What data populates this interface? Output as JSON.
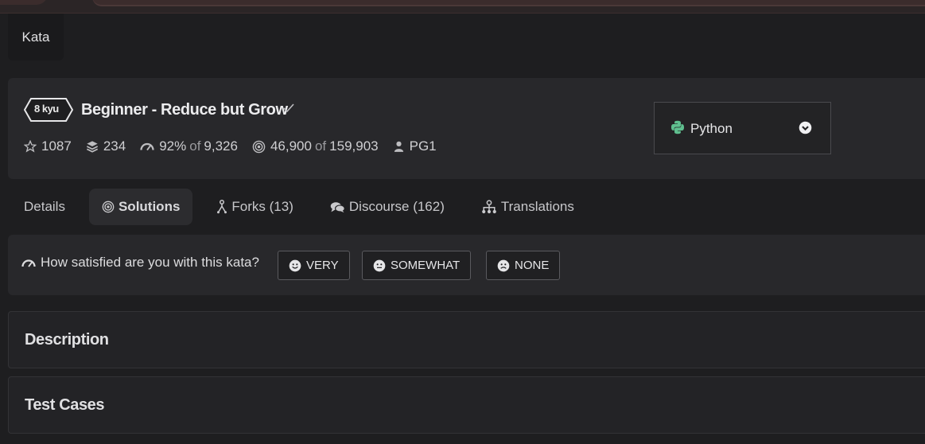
{
  "nav": {
    "kata_tab": "Kata"
  },
  "kata": {
    "rank": "8 kyu",
    "title": "Beginner - Reduce but Grow",
    "stats": {
      "stars": "1087",
      "collections": "234",
      "satisfaction_pct": "92%",
      "satisfaction_of": "of",
      "satisfaction_votes": "9,326",
      "completed": "46,900",
      "completed_of": "of",
      "attempted": "159,903",
      "author": "PG1"
    }
  },
  "language_select": {
    "value": "Python",
    "icon": "python-icon"
  },
  "tabs": [
    {
      "label": "Details",
      "icon": ""
    },
    {
      "label": "Solutions",
      "icon": "target-icon",
      "active": true
    },
    {
      "label": "Forks (13)",
      "icon": "fork-icon"
    },
    {
      "label": "Discourse (162)",
      "icon": "chat-icon"
    },
    {
      "label": "Translations",
      "icon": "translations-icon"
    }
  ],
  "feedback": {
    "question": "How satisfied are you with this kata?",
    "options": [
      "VERY",
      "SOMEWHAT",
      "NONE"
    ]
  },
  "panels": {
    "description": "Description",
    "test_cases": "Test Cases"
  },
  "colors": {
    "background": "#1e1e20",
    "card": "#28282b",
    "python_green": "#5fbf8f"
  }
}
